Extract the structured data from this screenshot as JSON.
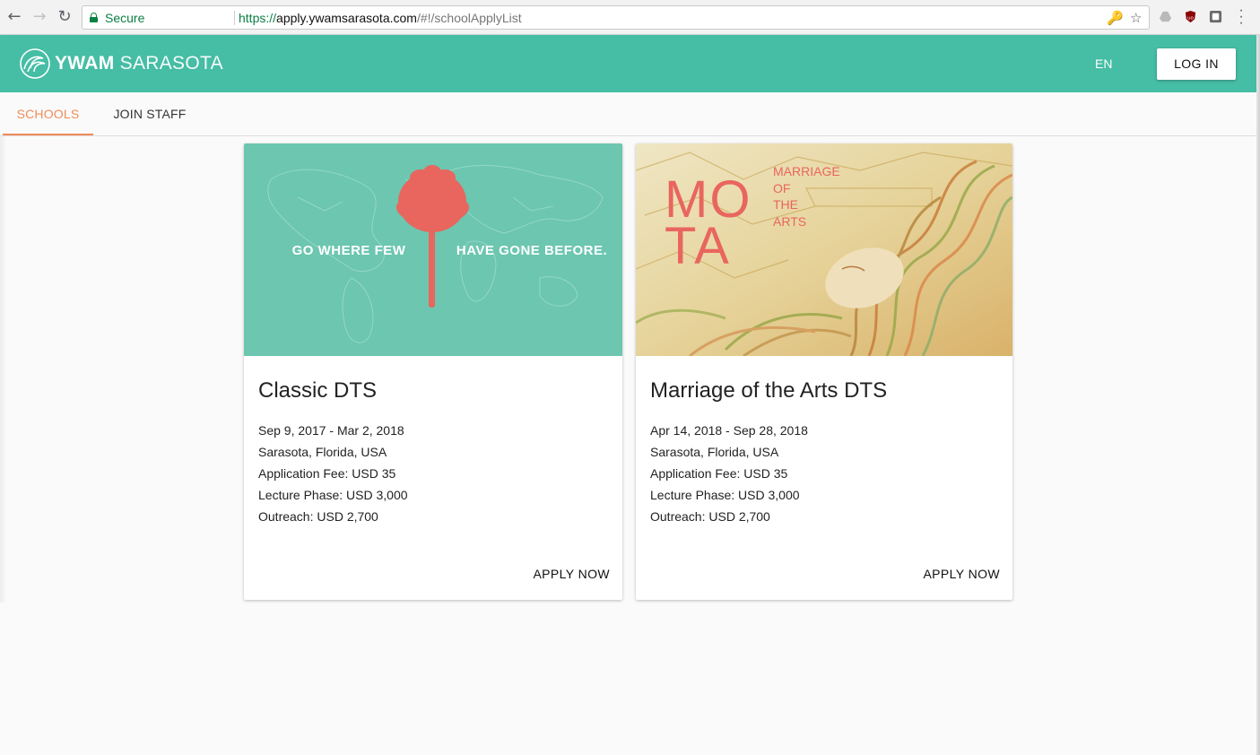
{
  "browser": {
    "secure_label": "Secure",
    "url_scheme": "https://",
    "url_host": "apply.ywamsarasota.com",
    "url_path": "/#!/schoolApplyList"
  },
  "header": {
    "brand_bold": "YWAM",
    "brand_light": "SARASOTA",
    "language": "EN",
    "login_label": "LOG IN",
    "color": "#46bda5"
  },
  "tabs": [
    {
      "label": "SCHOOLS",
      "active": true
    },
    {
      "label": "JOIN STAFF",
      "active": false
    }
  ],
  "accent_color": "#f08c5a",
  "cards": [
    {
      "title": "Classic DTS",
      "dates": "Sep 9, 2017 - Mar 2, 2018",
      "location": "Sarasota, Florida, USA",
      "application_fee": "Application Fee: USD 35",
      "lecture_phase": "Lecture Phase: USD 3,000",
      "outreach": "Outreach: USD 2,700",
      "action": "APPLY NOW",
      "image": {
        "tagline_left": "GO WHERE FEW",
        "tagline_right": "HAVE GONE BEFORE.",
        "background": "#6cc6b0"
      }
    },
    {
      "title": "Marriage of the Arts DTS",
      "dates": "Apr 14, 2018 - Sep 28, 2018",
      "location": "Sarasota, Florida, USA",
      "application_fee": "Application Fee: USD 35",
      "lecture_phase": "Lecture Phase: USD 3,000",
      "outreach": "Outreach: USD 2,700",
      "action": "APPLY NOW",
      "image": {
        "big_top": "MO",
        "big_bottom": "TA",
        "line1": "MARRIAGE",
        "line2": "OF",
        "line3": "THE",
        "line4": "ARTS",
        "background": "#e8d8a4"
      }
    }
  ]
}
